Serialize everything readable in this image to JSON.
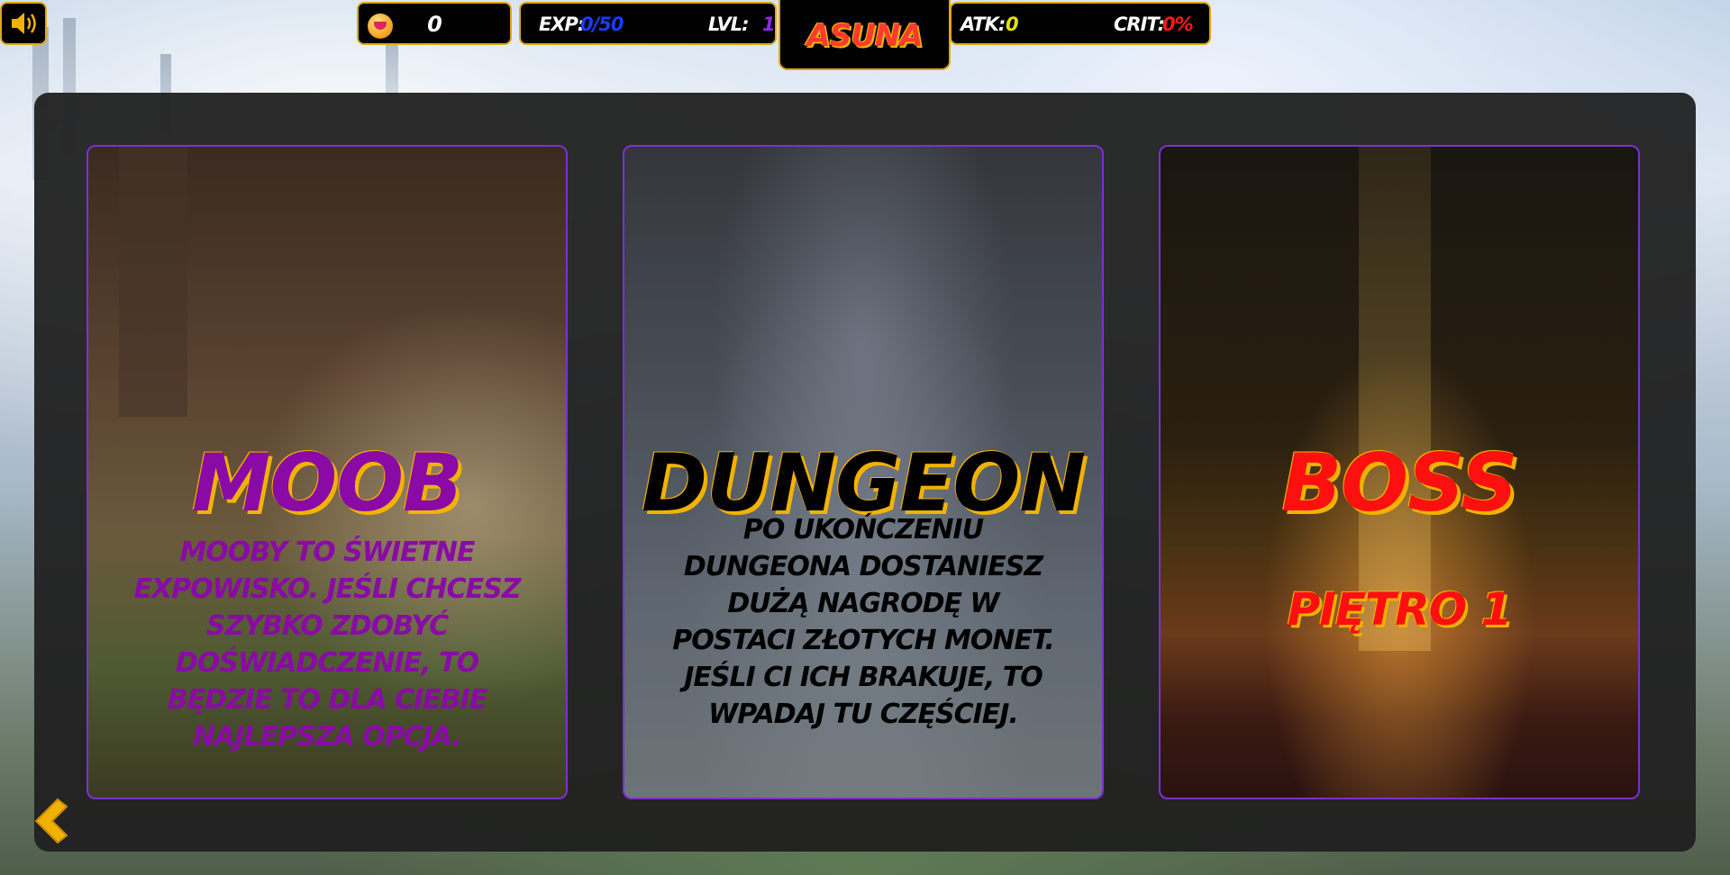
{
  "hud": {
    "coins": "0",
    "exp_label": "EXP:",
    "exp_value": "0/50",
    "lvl_label": "LVL:",
    "lvl_value": "1",
    "player_name": "ASUNA",
    "atk_label": "ATK:",
    "atk_value": "0",
    "crit_label": "CRIT:",
    "crit_value": "0%"
  },
  "cards": {
    "moob": {
      "title": "MOOB",
      "description": "MOOBY TO ŚWIETNE EXPOWISKO. JEŚLI CHCESZ SZYBKO ZDOBYĆ DOŚWIADCZENIE, TO BĘDZIE TO DLA CIEBIE NAJLEPSZA OPCJA."
    },
    "dungeon": {
      "title": "DUNGEON",
      "description": "PO UKOŃCZENIU DUNGEONA DOSTANIESZ DUŻĄ NAGRODĘ W POSTACI ZŁOTYCH MONET. JEŚLI CI ICH BRAKUJE, TO WPADAJ TU CZĘŚCIEJ."
    },
    "boss": {
      "title": "BOSS",
      "floor": "PIĘTRO 1"
    }
  },
  "icons": {
    "sound": "speaker-icon",
    "coin": "coin-icon",
    "back": "chevron-left-icon"
  },
  "colors": {
    "accent_gold": "#e0a816",
    "moob_purple": "#8a0aa6",
    "boss_red": "#ff1010",
    "exp_blue": "#1a3cff",
    "lvl_purple": "#8a2be2",
    "atk_yellow": "#e8e000",
    "crit_red": "#ff1a1a",
    "card_border": "#7d2fd6"
  }
}
